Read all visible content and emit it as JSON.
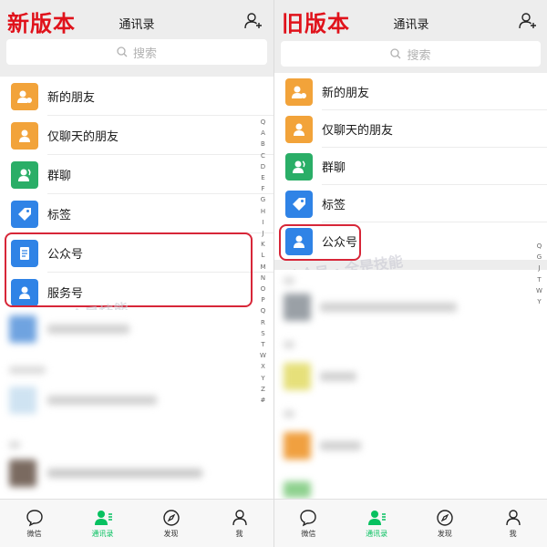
{
  "left": {
    "badge": "新版本",
    "title": "通讯录",
    "search_placeholder": "搜索",
    "items": [
      {
        "label": "新的朋友"
      },
      {
        "label": "仅聊天的朋友"
      },
      {
        "label": "群聊"
      },
      {
        "label": "标签"
      },
      {
        "label": "公众号"
      },
      {
        "label": "服务号"
      }
    ],
    "index_letters": [
      "Q",
      "A",
      "B",
      "C",
      "D",
      "E",
      "F",
      "G",
      "H",
      "I",
      "J",
      "K",
      "L",
      "M",
      "N",
      "O",
      "P",
      "Q",
      "R",
      "S",
      "T",
      "W",
      "X",
      "Y",
      "Z",
      "#"
    ]
  },
  "right": {
    "badge": "旧版本",
    "title": "通讯录",
    "search_placeholder": "搜索",
    "items": [
      {
        "label": "新的朋友"
      },
      {
        "label": "仅聊天的朋友"
      },
      {
        "label": "群聊"
      },
      {
        "label": "标签"
      },
      {
        "label": "公众号"
      }
    ],
    "index_letters": [
      "Q",
      "G",
      "J",
      "T",
      "W",
      "Y"
    ]
  },
  "tabs": [
    {
      "label": "微信",
      "icon": "chat-icon",
      "active": false
    },
    {
      "label": "通讯录",
      "icon": "contacts-icon",
      "active": true
    },
    {
      "label": "发现",
      "icon": "compass-icon",
      "active": false
    },
    {
      "label": "我",
      "icon": "person-icon",
      "active": false
    }
  ],
  "colors": {
    "highlight": "#d72638",
    "badge_red": "#e0121b",
    "active_tab": "#07c160"
  }
}
